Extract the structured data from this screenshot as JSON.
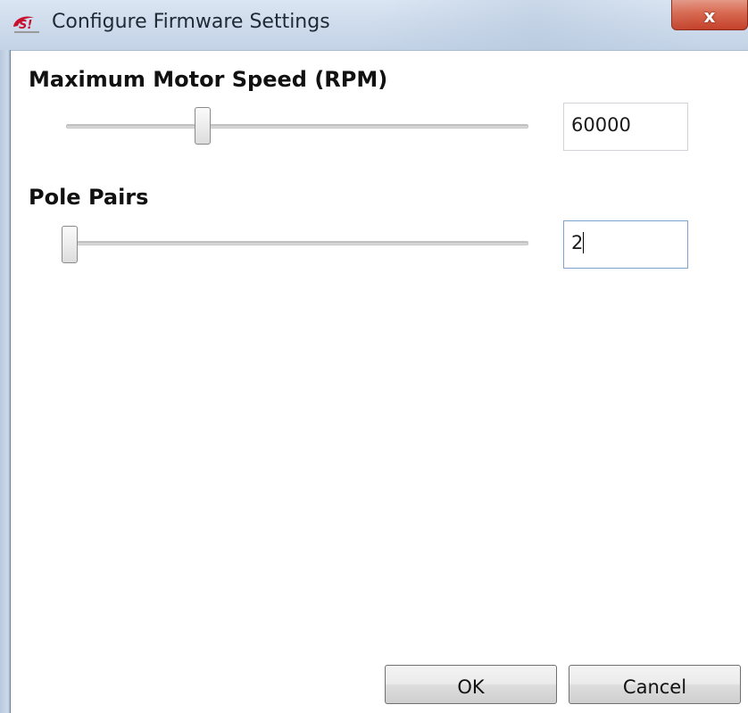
{
  "window": {
    "title": "Configure Firmware Settings",
    "icon": "silicon-labs-logo",
    "close_label": "x"
  },
  "settings": [
    {
      "label": "Maximum Motor Speed (RPM)",
      "value": "60000",
      "slider_fraction": 0.3
    },
    {
      "label": "Pole Pairs",
      "value": "2",
      "slider_fraction": 0.0
    }
  ],
  "buttons": {
    "ok_label": "OK",
    "cancel_label": "Cancel"
  },
  "colors": {
    "titlebar": "#cfdcec",
    "close_button": "#d86a52",
    "focus_border": "#7da2ce"
  }
}
